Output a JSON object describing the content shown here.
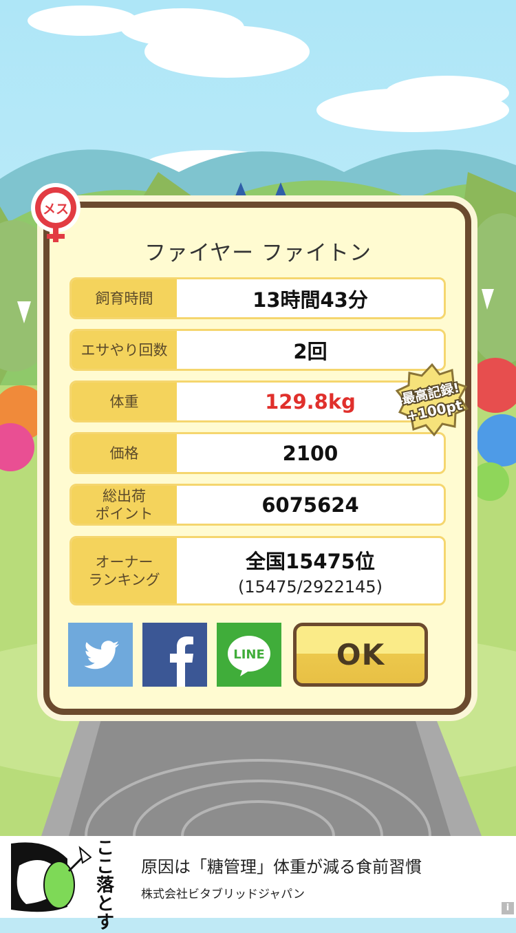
{
  "pet": {
    "gender_badge": "メス",
    "name": "ファイヤー ファイトン"
  },
  "stats": [
    {
      "label": "飼育時間",
      "value": "13時間43分"
    },
    {
      "label": "エサやり回数",
      "value": "2回"
    },
    {
      "label": "体重",
      "value": "129.8kg"
    },
    {
      "label": "価格",
      "value": "2100"
    },
    {
      "label_line1": "総出荷",
      "label_line2": "ポイント",
      "value": "6075624"
    },
    {
      "label_line1": "オーナー",
      "label_line2": "ランキング",
      "value": "全国15475位",
      "sub": "(15475/2922145)"
    }
  ],
  "record_badge": {
    "line1": "最高記録!",
    "line2": "+100pt"
  },
  "buttons": {
    "ok": "OK",
    "line": "LINE"
  },
  "ad": {
    "title": "原因は「糖管理」体重が減る食前習慣",
    "company": "株式会社ビタブリッドジャパン",
    "vertical": "ここ落とす",
    "info": "i"
  },
  "colors": {
    "record_red": "#e0302c",
    "panel_border": "#6b4a2e",
    "label_bg": "#f4d35c",
    "twitter": "#6fa9dc",
    "facebook": "#3b5795",
    "line": "#40ad3a"
  },
  "icons": [
    "female-icon",
    "twitter-icon",
    "facebook-icon",
    "line-icon",
    "record-star-icon"
  ]
}
